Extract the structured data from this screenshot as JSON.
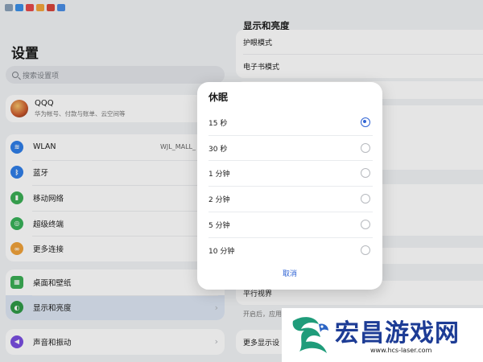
{
  "colors": {
    "accent": "#2f63d4",
    "selected_row": "#dde6f3",
    "page_bg": "#f1f3f5",
    "watermark_text": "#1d3c95"
  },
  "status_icons": [
    "wifi-icon",
    "notification-icon-1",
    "notification-icon-2",
    "notification-icon-3",
    "notification-icon-4",
    "notification-icon-5"
  ],
  "left": {
    "title": "设置",
    "search_placeholder": "搜索设置项",
    "account": {
      "name": "QQQ",
      "subtitle": "华为帐号、付款与账单、云空间等"
    },
    "group1": [
      {
        "label": "WLAN",
        "icon": "wifi-icon",
        "value": "WJL_MALL_"
      },
      {
        "label": "蓝牙",
        "icon": "bluetooth-icon",
        "value": ""
      },
      {
        "label": "移动网络",
        "icon": "signal-icon",
        "value": ""
      },
      {
        "label": "超级终端",
        "icon": "super-device-icon",
        "value": ""
      },
      {
        "label": "更多连接",
        "icon": "link-icon",
        "value": ""
      }
    ],
    "group2": [
      {
        "label": "桌面和壁纸",
        "icon": "wallpaper-icon"
      },
      {
        "label": "显示和亮度",
        "icon": "display-icon"
      }
    ],
    "group3": [
      {
        "label": "声音和振动",
        "icon": "sound-icon"
      }
    ]
  },
  "right": {
    "title": "显示和亮度",
    "rows_top": [
      "护眼模式",
      "电子书模式"
    ],
    "row_parallel": "平行视界",
    "parallel_desc": "开启后，应用",
    "row_more": "更多显示设"
  },
  "dialog": {
    "title": "休眠",
    "options": [
      "15 秒",
      "30 秒",
      "1 分钟",
      "2 分钟",
      "5 分钟",
      "10 分钟"
    ],
    "selected": "15 秒",
    "cancel": "取消"
  },
  "watermark": {
    "title": "宏昌游戏网",
    "url": "www.hcs-laser.com"
  }
}
